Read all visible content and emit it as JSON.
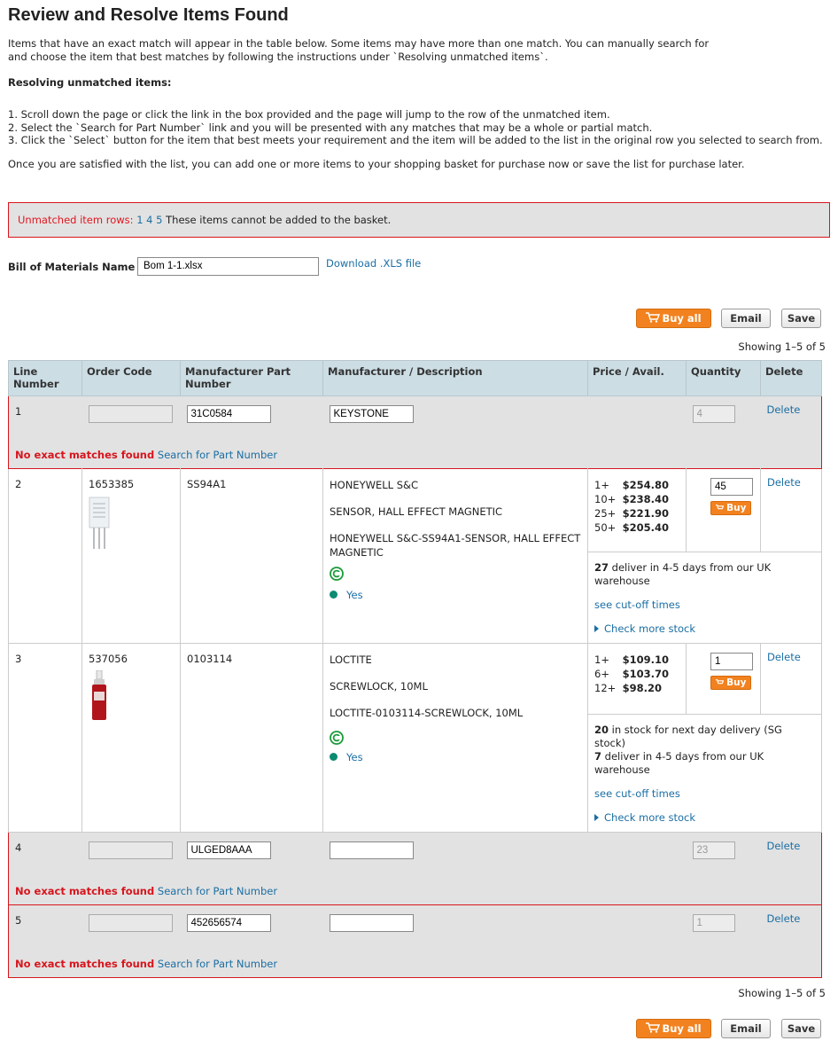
{
  "header": {
    "title": "Review and Resolve Items Found"
  },
  "intro": {
    "paragraph": "Items that have an exact match will appear in the table below. Some items may have more than one match. You can manually search for and choose the item that best matches by following the instructions under `Resolving unmatched items`.",
    "resolving_title": "Resolving unmatched items:",
    "steps": [
      "1.  Scroll down the page or click the link in the box provided and the page will jump to the row of the unmatched item.",
      "2.  Select the `Search for Part Number` link and you will be presented with any matches that may be a whole or partial match.",
      "3.  Click the `Select` button for the item that best meets your requirement and the item will be added to the list in the original row you selected to search from."
    ],
    "closing": "Once you are satisfied with the list, you can add one or more items to your shopping basket for purchase now or save the list for purchase later."
  },
  "unmatched": {
    "label": "Unmatched item rows:",
    "rows": [
      "1",
      "4",
      "5"
    ],
    "message": "These items cannot be added to the basket."
  },
  "bom": {
    "label": "Bill of Materials Name",
    "value": "Bom 1-1.xlsx",
    "download_label": "Download .XLS file"
  },
  "actions": {
    "buy_all": "Buy all",
    "email": "Email",
    "save": "Save"
  },
  "showing": "Showing 1–5 of 5",
  "table": {
    "headers": {
      "line": "Line Number",
      "order_code": "Order Code",
      "mpn": "Manufacturer Part Number",
      "mfr_desc": "Manufacturer / Description",
      "price": "Price / Avail.",
      "qty": "Quantity",
      "del": "Delete"
    },
    "delete_label": "Delete",
    "no_match_label": "No exact matches found",
    "search_label": "Search for Part Number",
    "buy_label": "Buy",
    "cutoff_label": "see cut-off times",
    "check_stock_label": "Check more stock",
    "rows": [
      {
        "line": "1",
        "order_code": "",
        "mpn": "31C0584",
        "manufacturer": "KEYSTONE",
        "qty": "4"
      },
      {
        "line": "2",
        "order_code": "1653385",
        "mpn": "SS94A1",
        "manufacturer": "HONEYWELL S&C",
        "description": "SENSOR, HALL EFFECT MAGNETIC",
        "full_description": "HONEYWELL S&C-SS94A1-SENSOR, HALL EFFECT MAGNETIC",
        "rohs_label": "Yes",
        "prices": [
          {
            "qty": "1+",
            "price": "$254.80"
          },
          {
            "qty": "10+",
            "price": "$238.40"
          },
          {
            "qty": "25+",
            "price": "$221.90"
          },
          {
            "qty": "50+",
            "price": "$205.40"
          }
        ],
        "qty": "45",
        "stock": [
          {
            "count": "27",
            "text": " deliver in 4-5 days from our UK warehouse"
          }
        ]
      },
      {
        "line": "3",
        "order_code": "537056",
        "mpn": "0103114",
        "manufacturer": "LOCTITE",
        "description": "SCREWLOCK, 10ML",
        "full_description": "LOCTITE-0103114-SCREWLOCK, 10ML",
        "rohs_label": "Yes",
        "prices": [
          {
            "qty": "1+",
            "price": "$109.10"
          },
          {
            "qty": "6+",
            "price": "$103.70"
          },
          {
            "qty": "12+",
            "price": "$98.20"
          }
        ],
        "qty": "1",
        "stock": [
          {
            "count": "20",
            "text": " in stock for next day delivery (SG stock)"
          },
          {
            "count": "7",
            "text": " deliver in 4-5 days from our UK warehouse"
          }
        ]
      },
      {
        "line": "4",
        "order_code": "",
        "mpn": "ULGED8AAA",
        "manufacturer": "",
        "qty": "23"
      },
      {
        "line": "5",
        "order_code": "",
        "mpn": "452656574",
        "manufacturer": "",
        "qty": "1"
      }
    ]
  },
  "colors": {
    "accent_orange": "#f2821f",
    "link_blue": "#1a6ea3",
    "error_red": "#d7161e",
    "header_blue": "#ccdde4",
    "rohs_green": "#0c8a72"
  }
}
